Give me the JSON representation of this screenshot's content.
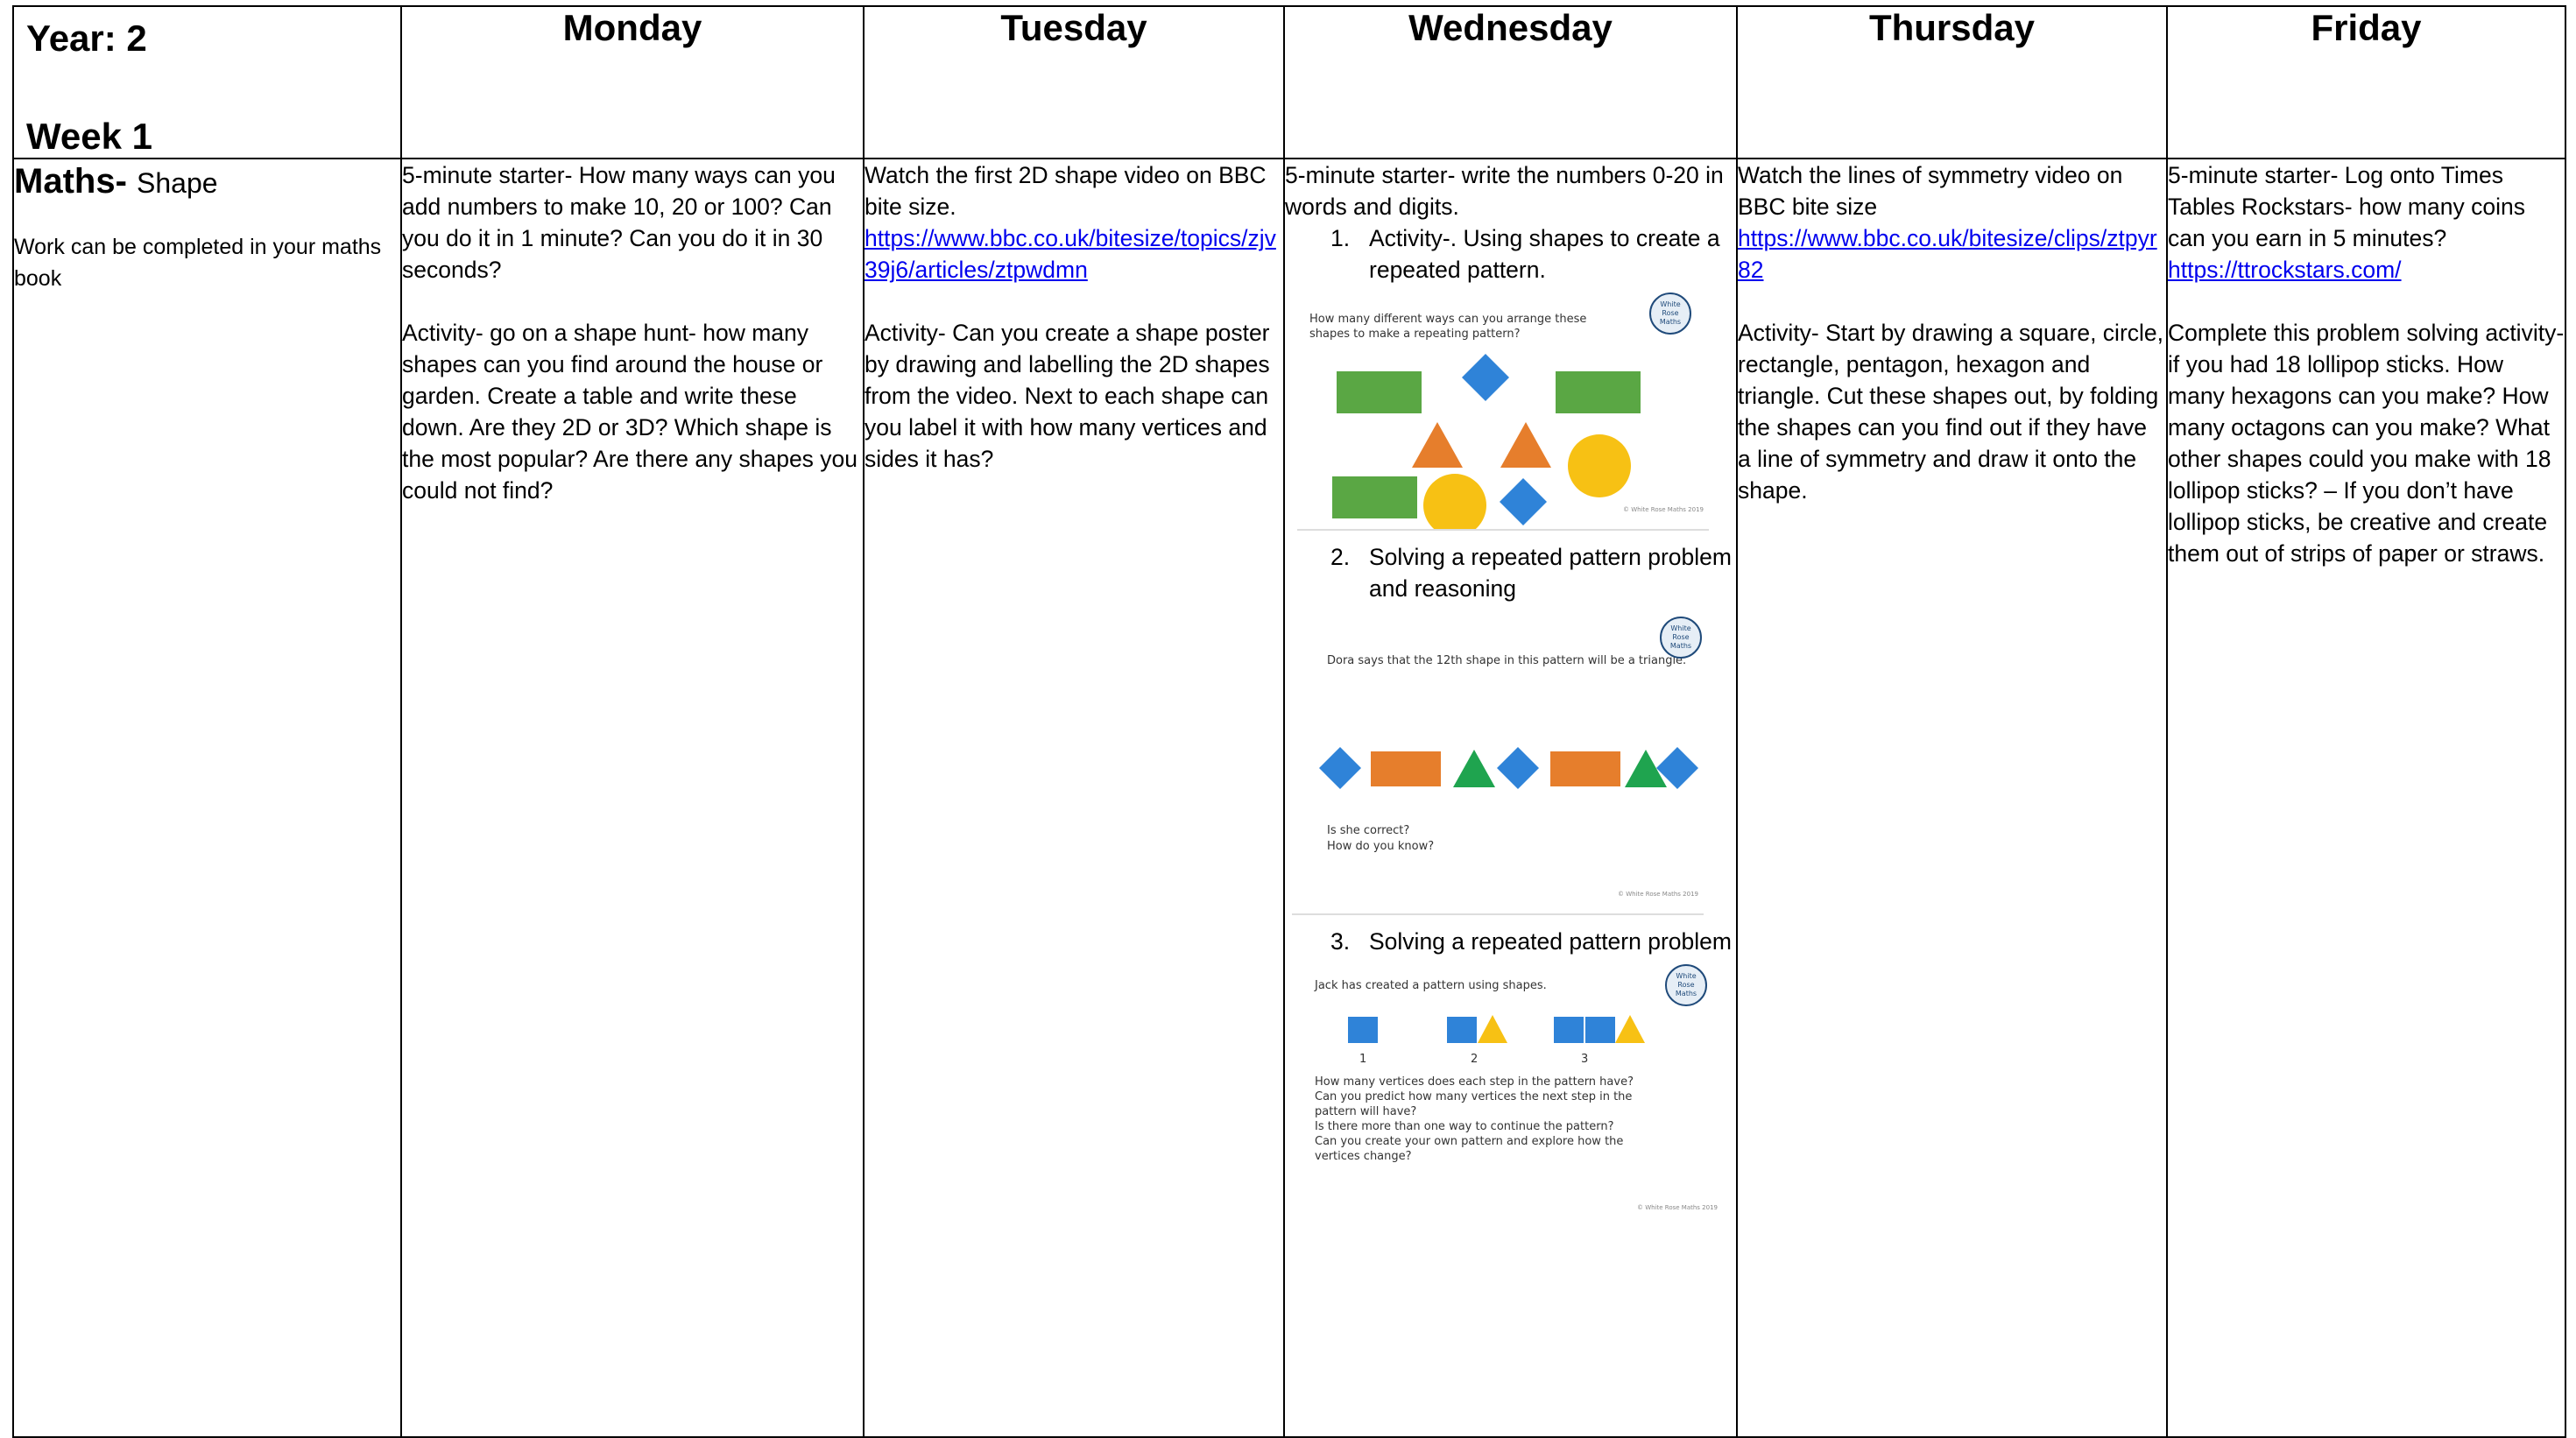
{
  "header": {
    "year_label": "Year: 2",
    "week_label": "Week 1",
    "days": [
      "Monday",
      "Tuesday",
      "Wednesday",
      "Thursday",
      "Friday"
    ]
  },
  "subject": {
    "title": "Maths-",
    "topic": "Shape",
    "note": "Work can be completed in your maths book"
  },
  "monday": {
    "starter": "5-minute starter- How many ways can you add numbers to make 10, 20 or 100? Can you do it in 1 minute? Can you do it in 30 seconds?",
    "activity": "Activity- go on a shape hunt- how many shapes can you find around the house or garden. Create a table and write these down. Are they 2D or 3D? Which shape is the most popular? Are there any shapes you could not find?"
  },
  "tuesday": {
    "intro": "Watch the first 2D shape video on BBC bite size.",
    "link": "https://www.bbc.co.uk/bitesize/topics/zjv39j6/articles/ztpwdmn",
    "activity": "Activity- Can you create a shape poster by drawing and labelling the 2D shapes from the video. Next to each shape can you label it with how many vertices and sides it has?"
  },
  "wednesday": {
    "starter": "5-minute starter- write the numbers 0-20 in words and digits.",
    "activities": [
      {
        "num": "1.",
        "text": "Activity-. Using shapes to create a repeated pattern."
      },
      {
        "num": "2.",
        "text": "Solving a repeated pattern problem and reasoning"
      },
      {
        "num": "3.",
        "text": "Solving a repeated pattern problem"
      }
    ],
    "sheet1": {
      "prompt": "How many different ways can you arrange these shapes to make a repeating pattern?",
      "badge": "White Rose Maths",
      "footer": "© White Rose Maths 2019"
    },
    "sheet2": {
      "prompt": "Dora says that the 12th shape in this pattern will be a triangle.",
      "q1": "Is she correct?",
      "q2": "How do you know?",
      "badge": "White Rose Maths",
      "footer": "© White Rose Maths 2019"
    },
    "sheet3": {
      "prompt": "Jack has created a pattern using shapes.",
      "steps": [
        "1",
        "2",
        "3"
      ],
      "questions": [
        "How many vertices does each step in the pattern have?",
        "Can you predict how many vertices the next step in the pattern will have?",
        "Is there more than one way to continue the pattern?",
        "Can you create your own pattern and explore how the vertices change?"
      ],
      "badge": "White Rose Maths",
      "footer": "© White Rose Maths 2019"
    }
  },
  "thursday": {
    "intro": "Watch the lines of symmetry video on BBC bite size",
    "link": "https://www.bbc.co.uk/bitesize/clips/ztpyr82",
    "activity": "Activity-  Start by drawing a square, circle, rectangle, pentagon, hexagon and triangle. Cut these shapes out, by folding the shapes can you find out if they have a line of symmetry and draw it onto the shape."
  },
  "friday": {
    "starter": "5-minute starter- Log onto Times Tables Rockstars- how many coins can you earn in 5 minutes?",
    "link": "https://ttrockstars.com/",
    "activity": "Complete this problem solving activity- if you had 18 lollipop sticks. How many hexagons can you make? How many octagons can you make? What other shapes could you make with 18 lollipop sticks? – If you don’t have lollipop sticks, be creative and create them out of strips of paper or straws."
  },
  "colors": {
    "green": "#5aa744",
    "blue": "#2f83d8",
    "orange": "#e67e2c",
    "yellow": "#f7c114",
    "link": "#0000ee"
  }
}
